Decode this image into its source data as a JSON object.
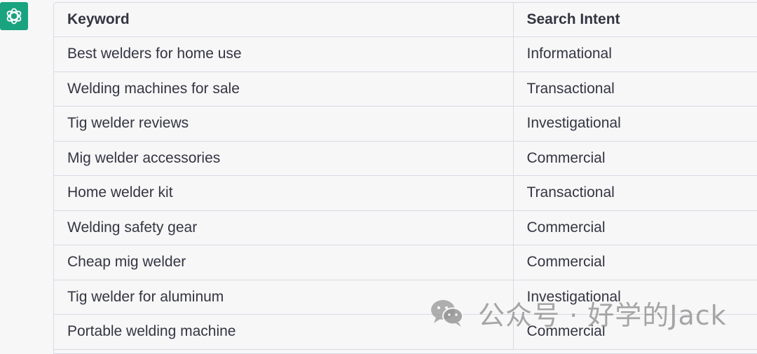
{
  "assistant": {
    "avatar_icon": "openai-logo-icon",
    "avatar_color": "#19a37f"
  },
  "table": {
    "headers": {
      "keyword": "Keyword",
      "intent": "Search Intent"
    },
    "rows": [
      {
        "keyword": "Best welders for home use",
        "intent": "Informational"
      },
      {
        "keyword": "Welding machines for sale",
        "intent": "Transactional"
      },
      {
        "keyword": "Tig welder reviews",
        "intent": "Investigational"
      },
      {
        "keyword": "Mig welder accessories",
        "intent": "Commercial"
      },
      {
        "keyword": "Home welder kit",
        "intent": "Transactional"
      },
      {
        "keyword": "Welding safety gear",
        "intent": "Commercial"
      },
      {
        "keyword": "Cheap mig welder",
        "intent": "Commercial"
      },
      {
        "keyword": "Tig welder for aluminum",
        "intent": "Investigational"
      },
      {
        "keyword": "Portable welding machine",
        "intent": "Commercial"
      }
    ]
  },
  "watermark": {
    "icon": "wechat-icon",
    "text": "公众号 · 好学的Jack"
  }
}
